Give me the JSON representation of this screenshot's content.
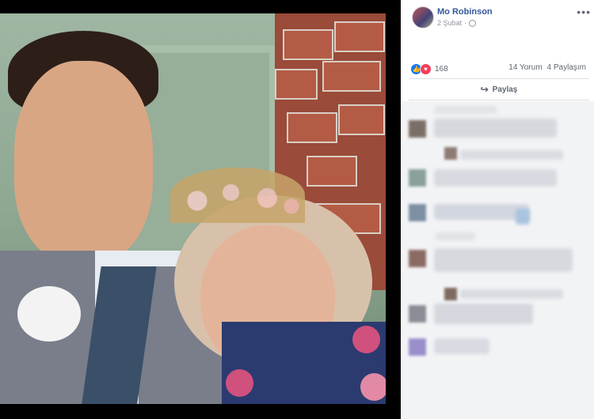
{
  "post": {
    "author": "Mo Robinson",
    "date": "2 Şubat",
    "reaction_count": "168",
    "comments": "14 Yorum",
    "shares": "4 Paylaşım",
    "share_label": "Paylaş"
  },
  "icons": {
    "more": "more-icon",
    "privacy": "globe-icon",
    "like": "like-icon",
    "love": "love-icon",
    "share": "share-icon"
  },
  "colors": {
    "link": "#365899",
    "like": "#1877f2",
    "love": "#f33e58"
  }
}
